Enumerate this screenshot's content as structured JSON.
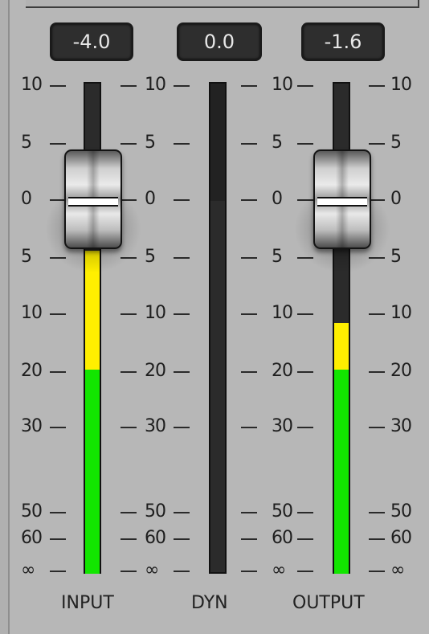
{
  "readouts": {
    "input": "-4.0",
    "dyn": "0.0",
    "output": "-1.6"
  },
  "scale": {
    "marks": [
      "10",
      "5",
      "0",
      "5",
      "10",
      "20",
      "30",
      "50",
      "60",
      "∞"
    ]
  },
  "channels": {
    "input": "INPUT",
    "dyn": "DYN",
    "output": "OUTPUT"
  },
  "meters": {
    "input_fader_db": -4.0,
    "output_fader_db": -1.6
  },
  "colors": {
    "background": "#b7b7b7",
    "meter_green": "#12e600",
    "meter_yellow": "#ffef00",
    "track": "#2b2b2b"
  }
}
